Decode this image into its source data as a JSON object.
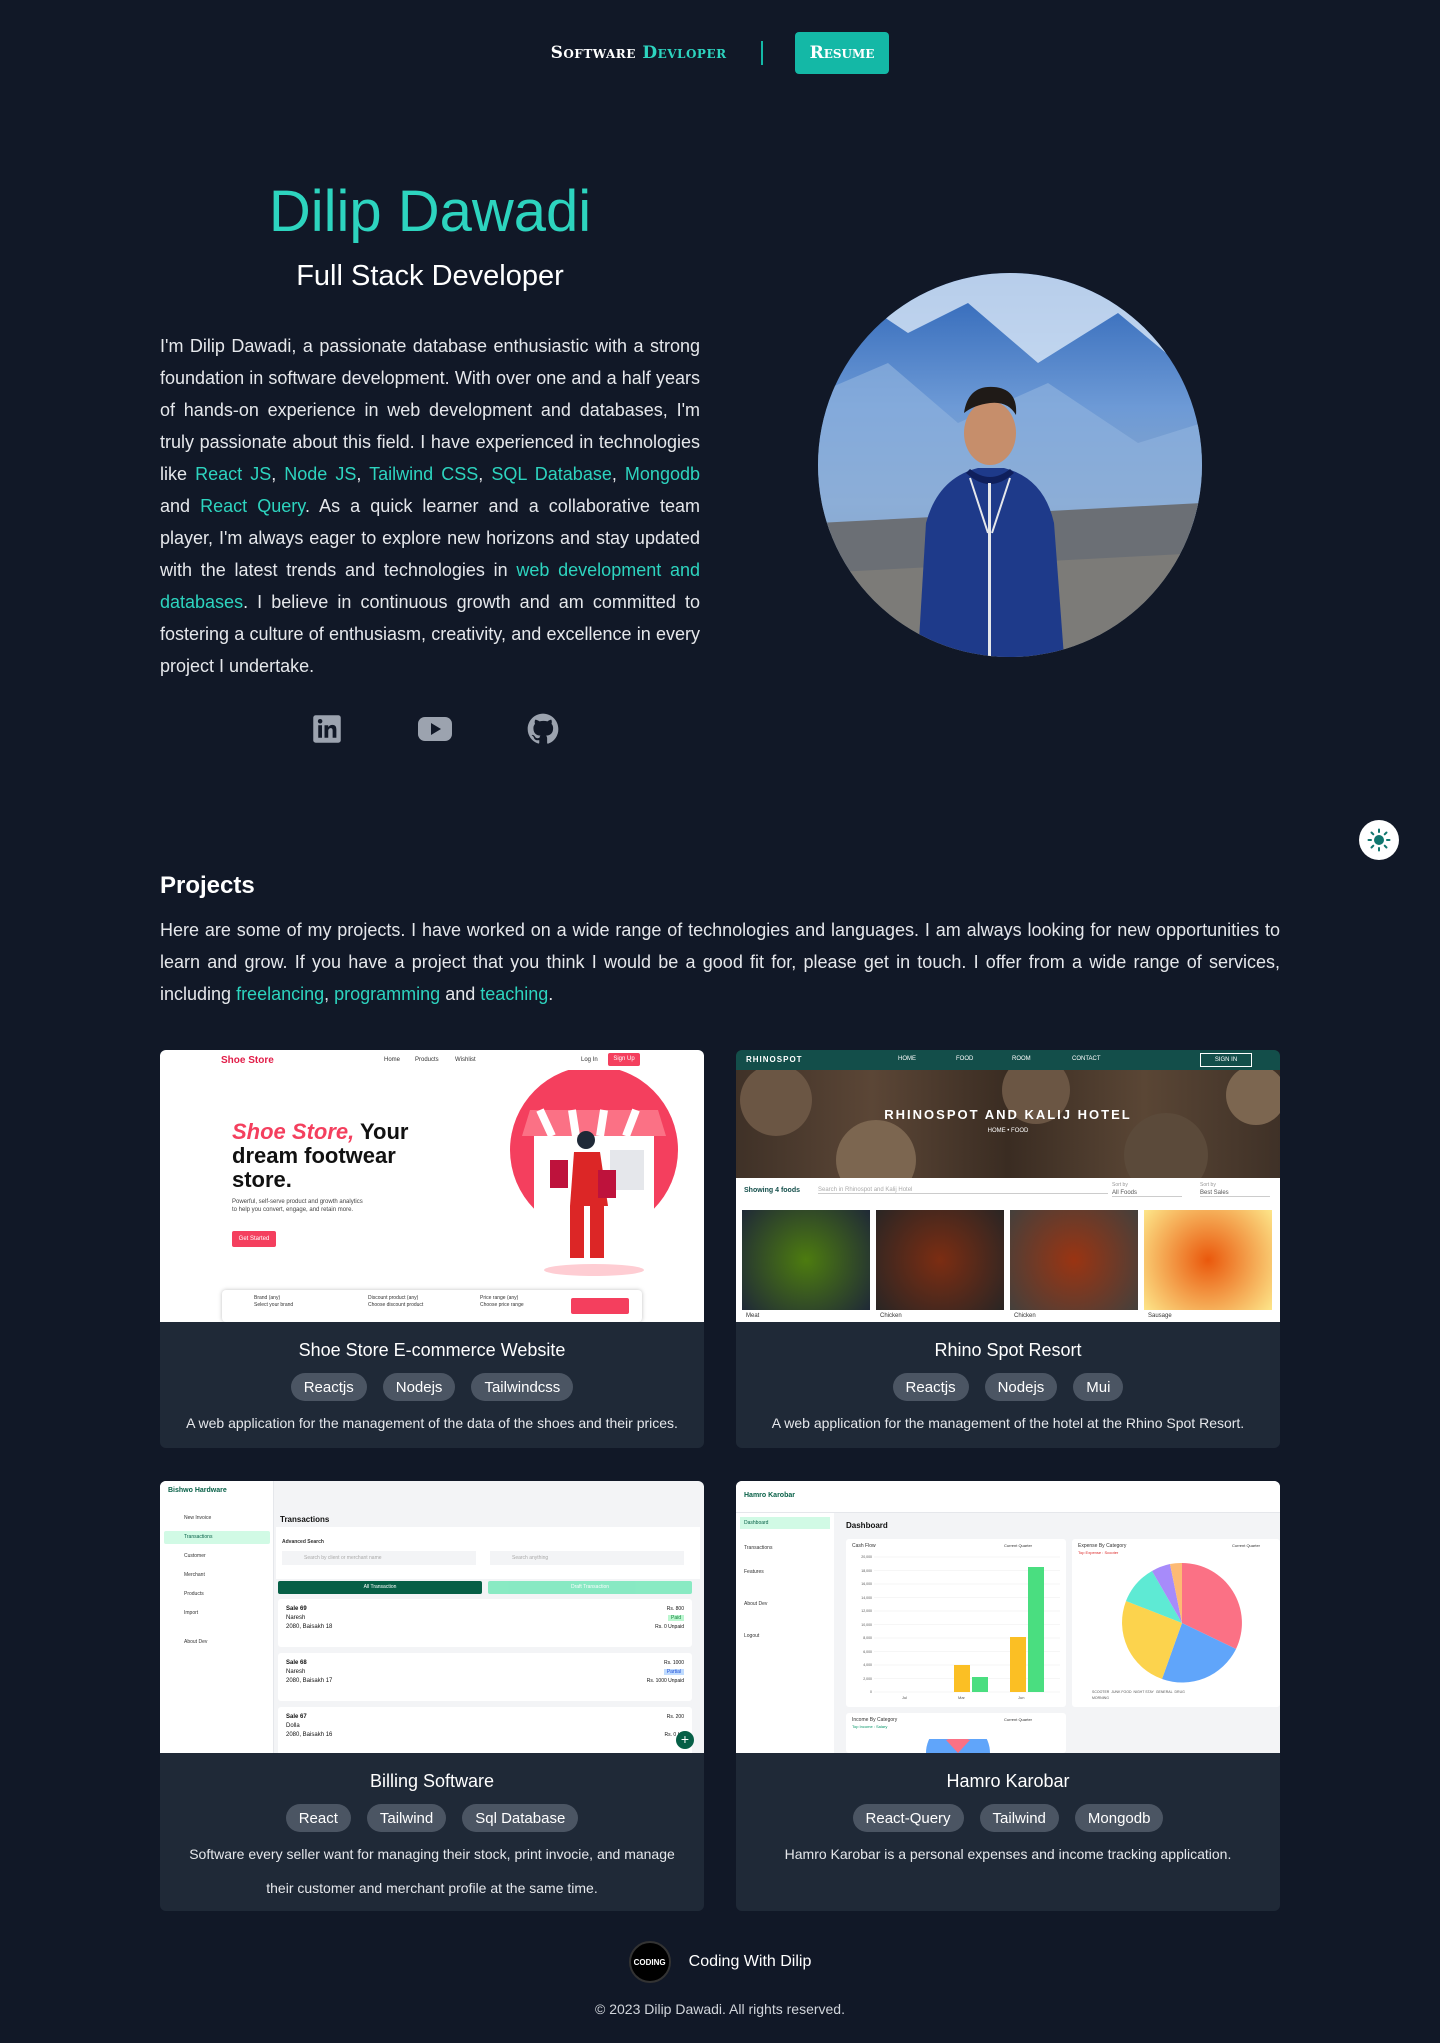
{
  "header": {
    "brand_part1": "Software",
    "brand_part2": "Devloper",
    "resume_label": "Resume"
  },
  "hero": {
    "name": "Dilip Dawadi",
    "role": "Full Stack Developer",
    "bio": {
      "t1": "I'm Dilip Dawadi, a passionate database enthusiastic with a strong foundation in software development. With over one and a half years of hands-on experience in web development and databases, I'm truly passionate about this field. I have experienced in technologies like ",
      "l1": "React JS",
      "c1": ", ",
      "l2": "Node JS",
      "c2": ", ",
      "l3": "Tailwind CSS",
      "c3": ", ",
      "l4": "SQL Database",
      "c4": ", ",
      "l5": "Mongodb",
      "t2": " and ",
      "l6": "React Query",
      "t3": ". As a quick learner and a collaborative team player, I'm always eager to explore new horizons and stay updated with the latest trends and technologies in ",
      "l7": "web development and databases",
      "t4": ". I believe in continuous growth and am committed to fostering a culture of enthusiasm, creativity, and excellence in every project I undertake."
    },
    "socials": [
      "linkedin-icon",
      "youtube-icon",
      "github-icon"
    ]
  },
  "projects": {
    "title": "Projects",
    "intro": {
      "t1": "Here are some of my projects. I have worked on a wide range of technologies and languages. I am always looking for new opportunities to learn and grow. If you have a project that you think I would be a good fit for, please get in touch. I offer from a wide range of services, including ",
      "l1": "freelancing",
      "c1": ", ",
      "l2": "programming",
      "t2": " and ",
      "l3": "teaching",
      "t3": "."
    },
    "cards": [
      {
        "title": "Shoe Store E-commerce Website",
        "tags": [
          "Reactjs",
          "Nodejs",
          "Tailwindcss"
        ],
        "desc": "A web application for the management of the data of the shoes and their prices.",
        "shot": {
          "logo": "Shoe Store",
          "nav": [
            "Home",
            "Products",
            "Wishlist"
          ],
          "login": "Log In",
          "signup": "Sign Up",
          "headline_accent": "Shoe Store,",
          "headline_rest1": " Your",
          "headline_rest2": "dream footwear",
          "headline_rest3": "store.",
          "sub1": "Powerful, self-serve product and growth analytics",
          "sub2": "to help you convert, engage, and retain more.",
          "cta": "Get Started",
          "filters": [
            "Brand (any)",
            "Discount product (any)",
            "Price range (any)"
          ],
          "filter_subs": [
            "Select your brand",
            "Choose discount product",
            "Choose price range"
          ]
        }
      },
      {
        "title": "Rhino Spot Resort",
        "tags": [
          "Reactjs",
          "Nodejs",
          "Mui"
        ],
        "desc": "A web application for the management of the hotel at the Rhino Spot Resort.",
        "shot": {
          "logo": "RHINOSPOT",
          "nav": [
            "HOME",
            "FOOD",
            "ROOM",
            "CONTACT"
          ],
          "signin": "SIGN IN",
          "hero": "RHINOSPOT AND KALIJ HOTEL",
          "crumb": "HOME • FOOD",
          "showing": "Showing 4 foods",
          "search_placeholder": "Search in Rhinospot and Kalij Hotel",
          "sort1_label": "Sort by",
          "sort1": "All Foods",
          "sort2_label": "Sort by",
          "sort2": "Best Sales",
          "foods": [
            "Meat",
            "Chicken",
            "Chicken",
            "Sausage"
          ]
        }
      },
      {
        "title": "Billing Software",
        "tags": [
          "React",
          "Tailwind",
          "Sql Database"
        ],
        "desc": "Software every seller want for managing their stock, print invocie, and manage their customer and merchant profile at the same time.",
        "shot": {
          "logo": "Bishwo Hardware",
          "menu": [
            "New Invoice",
            "Transactions",
            "Customer",
            "Merchant",
            "Products",
            "Import",
            "About Dev"
          ],
          "page": "Transactions",
          "adv": "Advanced Search",
          "search1": "Search by client or merchant name",
          "search2": "Search anything",
          "tab1": "All Transaction",
          "tab2": "Draft Transaction",
          "rows": [
            {
              "sale": "Sale 69",
              "name": "Naresh",
              "date": "2080, Baisakh 18",
              "amount": "Rs. 800",
              "status": "Paid",
              "unpaid": "Rs. 0 Unpaid"
            },
            {
              "sale": "Sale 68",
              "name": "Naresh",
              "date": "2080, Baisakh 17",
              "amount": "Rs. 1000",
              "status": "Partial",
              "unpaid": "Rs. 1000 Unpaid"
            },
            {
              "sale": "Sale 67",
              "name": "Dolla",
              "date": "2080, Baisakh 16",
              "amount": "Rs. 200",
              "status": "",
              "unpaid": "Rs. 0 Un"
            }
          ]
        }
      },
      {
        "title": "Hamro Karobar",
        "tags": [
          "React-Query",
          "Tailwind",
          "Mongodb"
        ],
        "desc": "Hamro Karobar is a personal expenses and income tracking application.",
        "shot": {
          "logo": "Hamro Karobar",
          "menu": [
            "Dashboard",
            "Transactions",
            "Features",
            "About Dev",
            "Logout"
          ],
          "page": "Dashboard",
          "cash_flow": "Cash Flow",
          "current_quarter": "Current Quarter",
          "expense_title": "Expense By Category",
          "expense_sub": "Top Expense : Scooter",
          "income_title": "Income By Category",
          "income_sub": "Top Income : Salary",
          "yticks": [
            "20,000",
            "18,000",
            "16,000",
            "14,000",
            "12,000",
            "10,000",
            "8,000",
            "6,000",
            "4,000",
            "2,000",
            "0"
          ],
          "months": [
            "Jul",
            "Mar",
            "Jun"
          ],
          "legend": [
            "SCOOTER",
            "JUNK FOOD",
            "NIGHT STAY",
            "GENERAL",
            "DRUG",
            "MORNING"
          ]
        }
      }
    ]
  },
  "footer": {
    "logo_text": "CODING",
    "brand": "Coding With Dilip",
    "copyright": "© 2023 Dilip Dawadi. All rights reserved."
  },
  "colors": {
    "background": "#111827",
    "card": "#1f2937",
    "accent": "#2dd4bf",
    "button": "#14b8a6",
    "tag": "#4b5563"
  }
}
